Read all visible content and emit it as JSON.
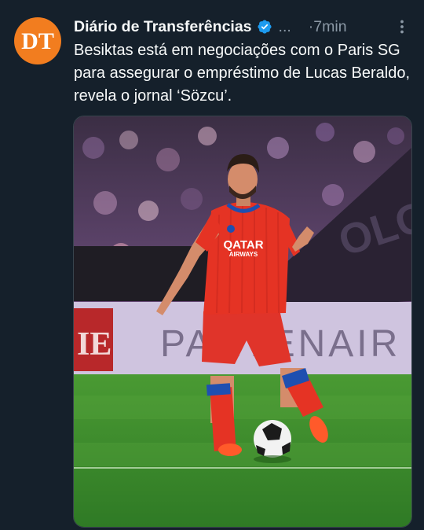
{
  "tweet": {
    "author": {
      "avatar_text": "DT",
      "display_name": "Diário de Transferências",
      "handle": "...",
      "verified_icon": "verified-badge-icon"
    },
    "time": "·7min",
    "text": "Besiktas está em negociações com o Paris SG para assegurar o empréstimo de Lucas Beraldo, revela o jornal ‘Sözcu’.",
    "more_icon": "more-vertical-icon",
    "media": {
      "jersey_text_1": "QATAR",
      "jersey_text_2": "AIRWAYS",
      "banner_text": "PARTENAIR",
      "side_banner_text": "IE",
      "fence_text": "OLOS"
    }
  },
  "colors": {
    "background": "#15202b",
    "avatar": "#f27d1f",
    "verified": "#1d9bf0",
    "muted_text": "#8b98a5",
    "pitch": "#3f8a2e",
    "kit": "#e53324"
  }
}
